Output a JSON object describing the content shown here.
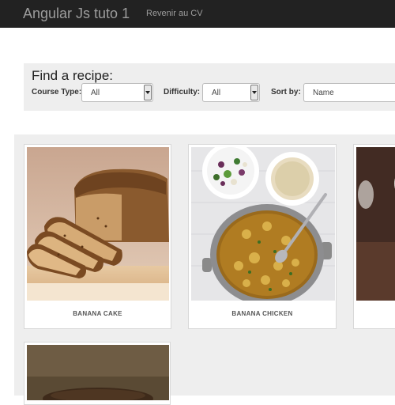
{
  "navbar": {
    "brand": "Angular Js tuto 1",
    "link": "Revenir au CV"
  },
  "search": {
    "title": "Find a recipe:",
    "course_label": "Course Type:",
    "course_value": "All",
    "difficulty_label": "Difficulty:",
    "difficulty_value": "All",
    "sort_label": "Sort by:",
    "sort_value": "Name"
  },
  "recipes": [
    {
      "name": "BANANA CAKE"
    },
    {
      "name": "BANANA CHICKEN"
    }
  ],
  "colors": {
    "navbar": "#222222",
    "panel": "#eeeeee"
  }
}
